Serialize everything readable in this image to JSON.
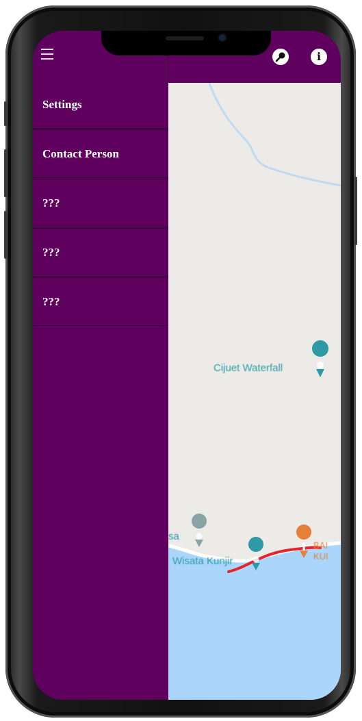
{
  "toolbar": {
    "menu_icon": "hamburger-menu-icon",
    "search_icon": "magnifier-icon",
    "info_icon": "info-icon",
    "info_glyph": "i"
  },
  "drawer": {
    "items": [
      {
        "label": "Settings"
      },
      {
        "label": "Contact Person"
      },
      {
        "label": "???"
      },
      {
        "label": "???"
      },
      {
        "label": "???"
      }
    ]
  },
  "map": {
    "labels": {
      "waterfall": "Cijuet Waterfall",
      "partial_left": "sa",
      "wisata": "Wisata Kunjir",
      "partial_right_1": "BAI",
      "partial_right_2": "KUI"
    },
    "colors": {
      "land": "#ecebe7",
      "water": "#abd6fb",
      "route": "#e8242b",
      "poi_teal": "#2d9aa5",
      "poi_orange": "#e57f39"
    }
  },
  "colors": {
    "primary": "#5f005f",
    "divider": "#2b002b"
  }
}
